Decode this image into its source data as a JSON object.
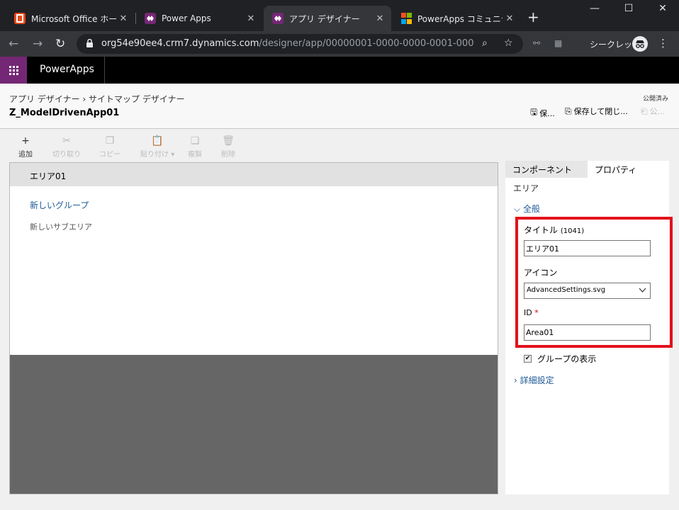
{
  "browser": {
    "tabs": [
      {
        "title": "Microsoft Office ホーム",
        "icon": "office-icon",
        "color": "#e64a19"
      },
      {
        "title": "Power Apps",
        "icon": "powerapps-icon",
        "color": "#742774"
      },
      {
        "title": "アプリ デザイナー",
        "icon": "powerapps-icon",
        "color": "#742774",
        "active": true
      },
      {
        "title": "PowerApps コミュニティ",
        "icon": "microsoft-icon"
      }
    ],
    "url_host": "org54e90ee4.crm7.dynamics.com",
    "url_path": "/designer/app/00000001-0000-0000-0001-00000...",
    "profile_label": "シークレット"
  },
  "app": {
    "name": "PowerApps",
    "accent": "#742774"
  },
  "header": {
    "breadcrumb_1": "アプリ デザイナー",
    "breadcrumb_2": "サイトマップ デザイナー",
    "title": "Z_ModelDrivenApp01",
    "publish_state": "公開済み",
    "save_label": "保...",
    "save_close_label": "保存して閉じ...",
    "publish_label": "公..."
  },
  "commands": [
    {
      "label": "追加",
      "icon": "plus-icon",
      "enabled": true
    },
    {
      "label": "切り取り",
      "icon": "cut-icon",
      "enabled": false
    },
    {
      "label": "コピー",
      "icon": "copy-icon",
      "enabled": false
    },
    {
      "label": "貼り付け",
      "icon": "paste-icon",
      "enabled": false
    },
    {
      "label": "複製",
      "icon": "clone-icon",
      "enabled": false
    },
    {
      "label": "削除",
      "icon": "delete-icon",
      "enabled": false
    }
  ],
  "canvas": {
    "area_tab": "エリア01",
    "group_label": "新しいグループ",
    "subarea_label": "新しいサブエリア"
  },
  "panel": {
    "tab_components": "コンポーネント",
    "tab_properties": "プロパティ",
    "section_type": "エリア",
    "general_label": "全般",
    "title_label": "タイトル",
    "title_code": "(1041)",
    "title_value": "エリア01",
    "icon_label": "アイコン",
    "icon_value": "AdvancedSettings.svg",
    "id_label": "ID",
    "id_required": "*",
    "id_value": "Area01",
    "show_groups_label": "グループの表示",
    "show_groups_checked": true,
    "advanced_label": "詳細設定"
  }
}
